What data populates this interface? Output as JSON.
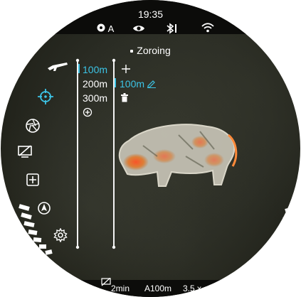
{
  "status": {
    "time": "19:35",
    "auto_label": "A"
  },
  "menu": {
    "title": "Zoroing"
  },
  "distances": {
    "items": [
      "100m",
      "200m",
      "300m"
    ],
    "selected_value": "100m"
  },
  "bottom_bar": {
    "timer": "2min",
    "zero_distance": "A100m",
    "zoom": "3.5 x"
  },
  "colors": {
    "accent": "#3cc4e6",
    "foreground": "#ffffff",
    "bar": "#0c0c0a"
  },
  "icons": {
    "sidebar": [
      "rifle-icon",
      "zeroing-crosshair-icon",
      "aperture-icon",
      "display-off-icon",
      "add-box-icon",
      "compass-icon",
      "settings-gear-icon"
    ]
  }
}
